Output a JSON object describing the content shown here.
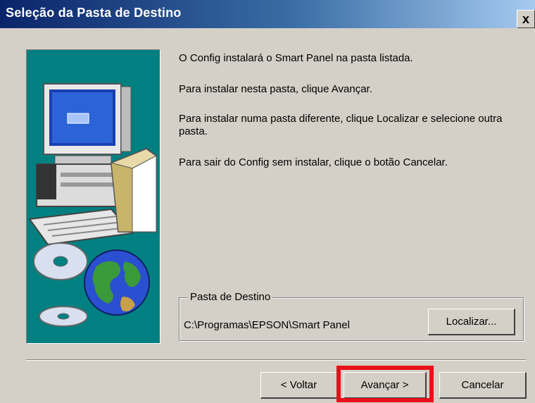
{
  "window": {
    "title": "Seleção da Pasta de Destino",
    "close_glyph": "x"
  },
  "messages": [
    "O Config instalará o Smart Panel na pasta listada.",
    "Para instalar nesta pasta, clique Avançar.",
    "Para instalar numa pasta diferente, clique Localizar e selecione outra pasta.",
    "Para sair do Config sem instalar, clique o botão Cancelar."
  ],
  "destination": {
    "group_label": "Pasta de Destino",
    "path": "C:\\Programas\\EPSON\\Smart Panel",
    "browse_label": "Localizar..."
  },
  "buttons": {
    "back": "< Voltar",
    "next": "Avançar >",
    "cancel": "Cancelar"
  },
  "colors": {
    "panel_bg": "#008080",
    "highlight": "#e8101a",
    "title_gradient_start": "#0a246a"
  }
}
